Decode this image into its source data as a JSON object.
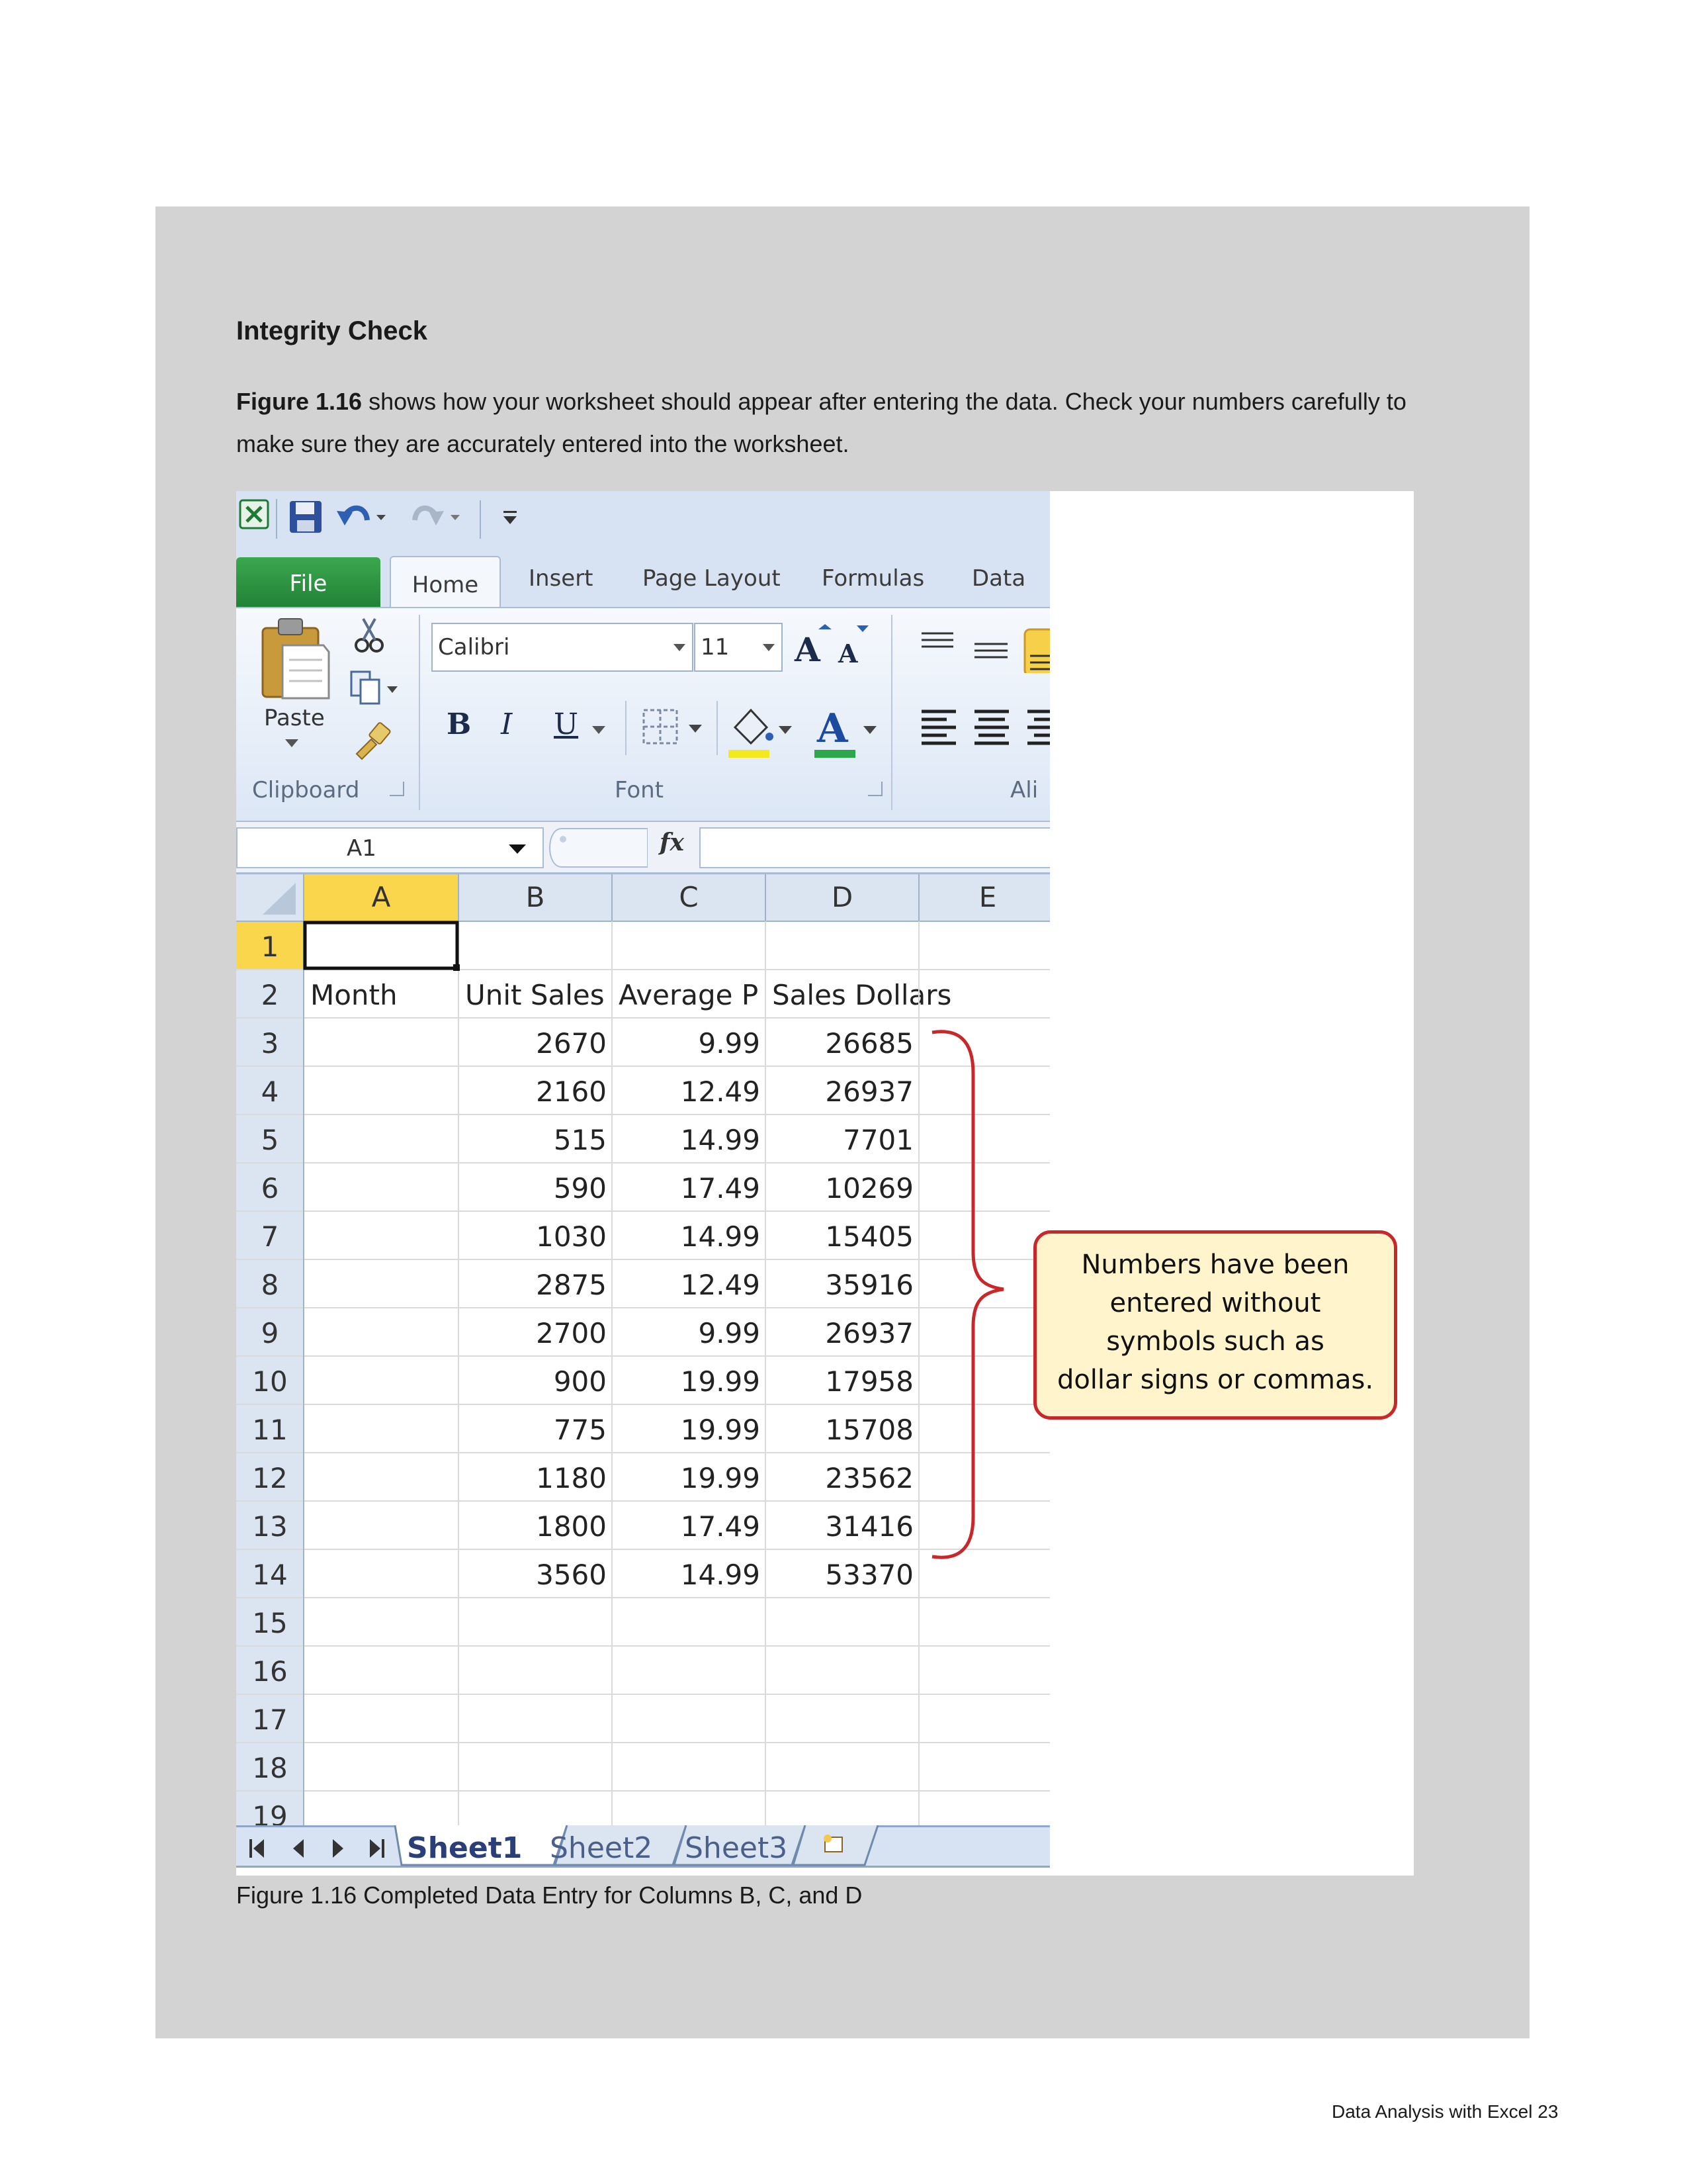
{
  "heading": "Integrity Check",
  "intro": {
    "bold": "Figure 1.16",
    "text": " shows how your worksheet should appear after entering the data. Check your numbers carefully to make sure they are accurately entered into the worksheet."
  },
  "excel": {
    "ribbon_tabs": [
      "File",
      "Home",
      "Insert",
      "Page Layout",
      "Formulas",
      "Data"
    ],
    "clipboard": {
      "paste_label": "Paste",
      "group_label": "Clipboard"
    },
    "font": {
      "name": "Calibri",
      "size": "11",
      "group_label": "Font",
      "bold": "B",
      "italic": "I",
      "underline": "U"
    },
    "alignment_group_label": "Ali",
    "name_box": "A1",
    "fx_label": "fx",
    "columns": [
      "A",
      "B",
      "C",
      "D",
      "E"
    ],
    "rows": [
      {
        "num": "1",
        "cells": [
          "",
          "",
          "",
          "",
          ""
        ]
      },
      {
        "num": "2",
        "cells": [
          "Month",
          "Unit Sales",
          "Average P",
          "Sales Dollars",
          ""
        ]
      },
      {
        "num": "3",
        "cells": [
          "",
          "2670",
          "9.99",
          "26685",
          ""
        ]
      },
      {
        "num": "4",
        "cells": [
          "",
          "2160",
          "12.49",
          "26937",
          ""
        ]
      },
      {
        "num": "5",
        "cells": [
          "",
          "515",
          "14.99",
          "7701",
          ""
        ]
      },
      {
        "num": "6",
        "cells": [
          "",
          "590",
          "17.49",
          "10269",
          ""
        ]
      },
      {
        "num": "7",
        "cells": [
          "",
          "1030",
          "14.99",
          "15405",
          ""
        ]
      },
      {
        "num": "8",
        "cells": [
          "",
          "2875",
          "12.49",
          "35916",
          ""
        ]
      },
      {
        "num": "9",
        "cells": [
          "",
          "2700",
          "9.99",
          "26937",
          ""
        ]
      },
      {
        "num": "10",
        "cells": [
          "",
          "900",
          "19.99",
          "17958",
          ""
        ]
      },
      {
        "num": "11",
        "cells": [
          "",
          "775",
          "19.99",
          "15708",
          ""
        ]
      },
      {
        "num": "12",
        "cells": [
          "",
          "1180",
          "19.99",
          "23562",
          ""
        ]
      },
      {
        "num": "13",
        "cells": [
          "",
          "1800",
          "17.49",
          "31416",
          ""
        ]
      },
      {
        "num": "14",
        "cells": [
          "",
          "3560",
          "14.99",
          "53370",
          ""
        ]
      },
      {
        "num": "15",
        "cells": [
          "",
          "",
          "",
          "",
          ""
        ]
      },
      {
        "num": "16",
        "cells": [
          "",
          "",
          "",
          "",
          ""
        ]
      },
      {
        "num": "17",
        "cells": [
          "",
          "",
          "",
          "",
          ""
        ]
      },
      {
        "num": "18",
        "cells": [
          "",
          "",
          "",
          "",
          ""
        ]
      },
      {
        "num": "19",
        "cells": [
          "",
          "",
          "",
          "",
          ""
        ]
      }
    ],
    "sheet_tabs": [
      "Sheet1",
      "Sheet2",
      "Sheet3"
    ],
    "active_sheet": "Sheet1"
  },
  "callout": {
    "lines": [
      "Numbers have been",
      "entered without",
      "symbols such as",
      "dollar signs or commas."
    ]
  },
  "caption": "Figure 1.16  Completed Data Entry for Columns B, C, and D",
  "footer": "Data Analysis with Excel 23",
  "colors": {
    "panel": "#d3d3d3",
    "selected_header": "#f9d64b",
    "header_bg": "#dbe5f1",
    "callout_border": "#c8282a",
    "callout_fill": "#fff4cc",
    "file_tab": "#2a8f3f"
  }
}
